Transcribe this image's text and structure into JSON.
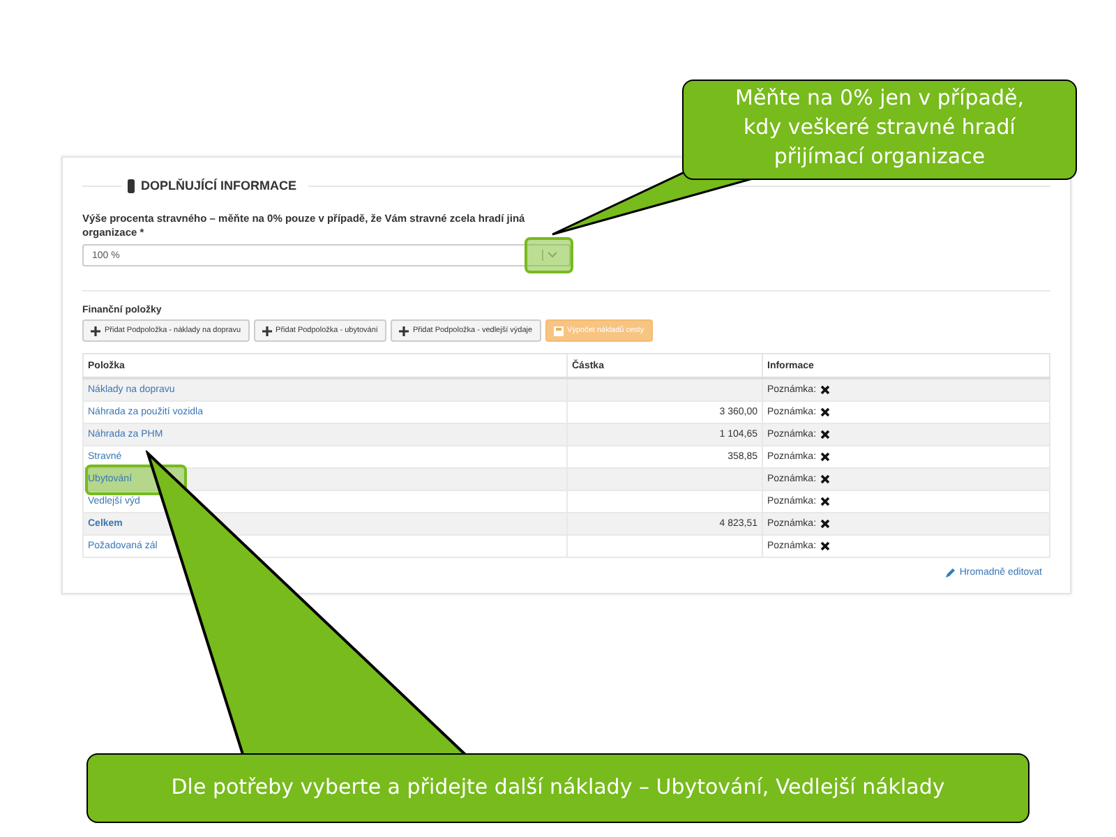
{
  "section": {
    "title": "DOPLŇUJÍCÍ INFORMACE"
  },
  "percent_field": {
    "label": "Výše procenta stravného – měňte na 0% pouze v případě, že Vám stravné zcela hradí jiná organizace *",
    "value": "100 %",
    "highlighted": true
  },
  "financial": {
    "title": "Finanční položky",
    "buttons": [
      {
        "label": "Přidat Podpoložka - náklady na dopravu",
        "kind": "add"
      },
      {
        "label": "Přidat Podpoložka - ubytování",
        "kind": "add"
      },
      {
        "label": "Přidat Podpoložka - vedlejší výdaje",
        "kind": "add"
      },
      {
        "label": "Výpočet nákladů cesty",
        "kind": "calculate"
      }
    ]
  },
  "table": {
    "columns": [
      "Položka",
      "Částka",
      "Informace"
    ],
    "rows": [
      {
        "item": "Náklady na dopravu",
        "amount": "",
        "info": "Poznámka:",
        "kind": "item"
      },
      {
        "item": "Náhrada za použití vozidla",
        "amount": "3 360,00",
        "info": "Poznámka:",
        "kind": "item"
      },
      {
        "item": "Náhrada za PHM",
        "amount": "1 104,65",
        "info": "Poznámka:",
        "kind": "item"
      },
      {
        "item": "Stravné",
        "amount": "358,85",
        "info": "Poznámka:",
        "kind": "item"
      },
      {
        "item": "Ubytování",
        "amount": "",
        "info": "Poznámka:",
        "kind": "item",
        "highlighted": true
      },
      {
        "item": "Vedlejší výd",
        "amount": "",
        "info": "Poznámka:",
        "kind": "item"
      },
      {
        "item": "Celkem",
        "amount": "4 823,51",
        "info": "Poznámka:",
        "kind": "total"
      },
      {
        "item": "Požadovaná zál",
        "amount": "",
        "info": "Poznámka:",
        "kind": "item"
      }
    ]
  },
  "bulk_edit_link": "Hromadně editovat",
  "callouts": [
    {
      "text": "Měňte na 0% jen v případě, kdy veškeré stravné hradí přijímací organizace"
    },
    {
      "text": "Dle potřeby vyberte a přidejte další náklady – Ubytování, Vedlejší náklady"
    }
  ]
}
